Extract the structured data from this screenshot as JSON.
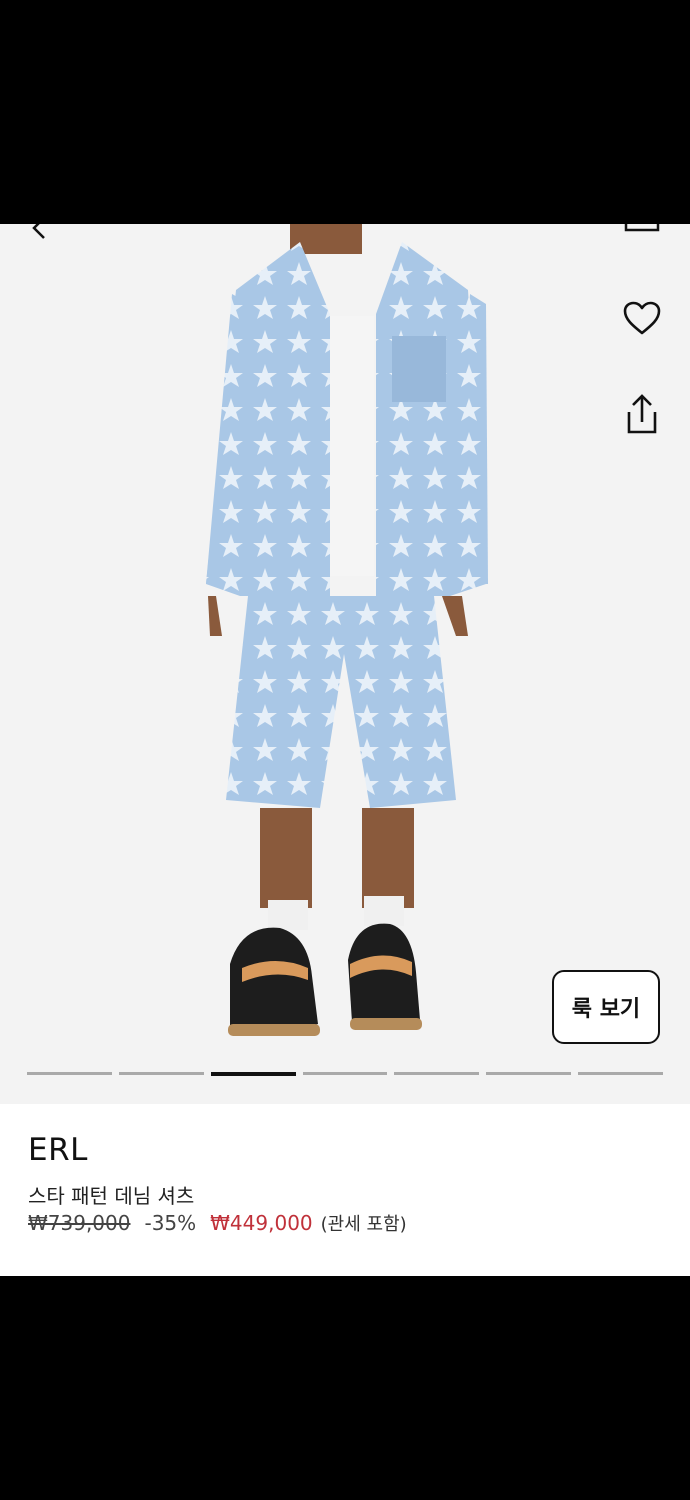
{
  "gallery": {
    "look_button_label": "룩 보기",
    "image_count": 7,
    "active_image_index": 3,
    "colors": {
      "background": "#f3f3f3",
      "denim": "#a9c7e6"
    }
  },
  "product": {
    "brand": "ERL",
    "title": "스타 패턴 데님 셔츠",
    "original_price": "₩739,000",
    "discount": "-35%",
    "sale_price": "₩449,000",
    "tax_note": "(관세 포함)",
    "colors": {
      "sale": "#c0313a"
    }
  }
}
